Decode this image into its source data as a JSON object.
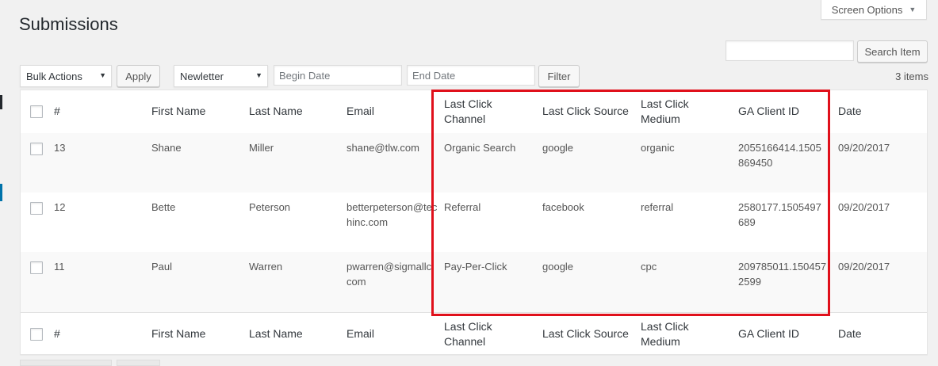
{
  "page": {
    "title": "Submissions",
    "screen_options_label": "Screen Options",
    "accent_highlight_color": "#e0101b"
  },
  "search": {
    "value": "",
    "button_label": "Search Item"
  },
  "toolbar": {
    "bulk_actions_label": "Bulk Actions",
    "apply_label": "Apply",
    "newsletter_label": "Newletter",
    "begin_date_placeholder": "Begin Date",
    "end_date_placeholder": "End Date",
    "filter_label": "Filter",
    "items_count": "3 items"
  },
  "table": {
    "headers": {
      "id": "#",
      "first_name": "First Name",
      "last_name": "Last Name",
      "email": "Email",
      "channel_l1": "Last Click",
      "channel_l2": "Channel",
      "source": "Last Click Source",
      "medium_l1": "Last Click",
      "medium_l2": "Medium",
      "ga_client_id": "GA Client ID",
      "date": "Date"
    },
    "rows": [
      {
        "id": "13",
        "first_name": "Shane",
        "last_name": "Miller",
        "email": "shane@tlw.com",
        "channel": "Organic Search",
        "source": "google",
        "medium": "organic",
        "ga_client_id": "2055166414.1505869450",
        "date": "09/20/2017"
      },
      {
        "id": "12",
        "first_name": "Bette",
        "last_name": "Peterson",
        "email": "betterpeterson@techinc.com",
        "channel": "Referral",
        "source": "facebook",
        "medium": "referral",
        "ga_client_id": "2580177.1505497689",
        "date": "09/20/2017"
      },
      {
        "id": "11",
        "first_name": "Paul",
        "last_name": "Warren",
        "email": "pwarren@sigmallc.com",
        "channel": "Pay-Per-Click",
        "source": "google",
        "medium": "cpc",
        "ga_client_id": "209785011.1504572599",
        "date": "09/20/2017"
      }
    ]
  }
}
